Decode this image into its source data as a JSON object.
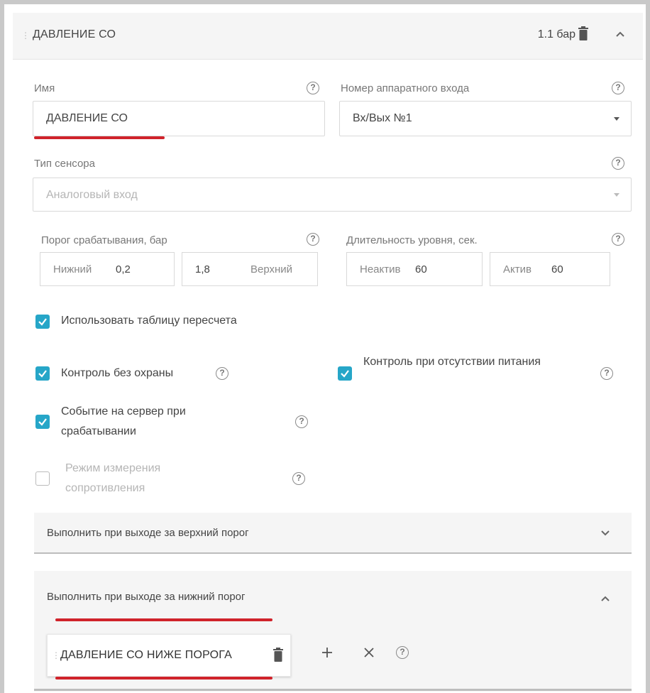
{
  "sensor": {
    "title": "ДАВЛЕНИЕ СО",
    "value": "1.1 бар"
  },
  "name_field": {
    "label": "Имя",
    "value": "ДАВЛЕНИЕ СО"
  },
  "input_field": {
    "label": "Номер аппаратного входа",
    "value": "Вх/Вых №1"
  },
  "sensor_type": {
    "label": "Тип сенсора",
    "value": "Аналоговый вход"
  },
  "threshold": {
    "label": "Порог срабатывания, бар",
    "lower_label": "Нижний",
    "lower_value": "0,2",
    "upper_value": "1,8",
    "upper_label": "Верхний"
  },
  "duration": {
    "label": "Длительность уровня, сек.",
    "inactive_label": "Неактив",
    "inactive_value": "60",
    "active_label": "Актив",
    "active_value": "60"
  },
  "checkboxes": {
    "recalc_table": "Использовать таблицу пересчета",
    "control_without_guard": "Контроль без охраны",
    "control_no_power": "Контроль при отсутствии питания",
    "event_to_server": "Событие на сервер при срабатывании",
    "resistance_mode": "Режим измерения сопротивления"
  },
  "accordions": {
    "upper": "Выполнить при выходе за верхний порог",
    "lower": "Выполнить при выходе за нижний порог"
  },
  "action_chip": {
    "label": "ДАВЛЕНИЕ СО НИЖЕ ПОРОГА"
  },
  "colors": {
    "accent": "#26a6c8",
    "highlight": "#d0232b"
  }
}
